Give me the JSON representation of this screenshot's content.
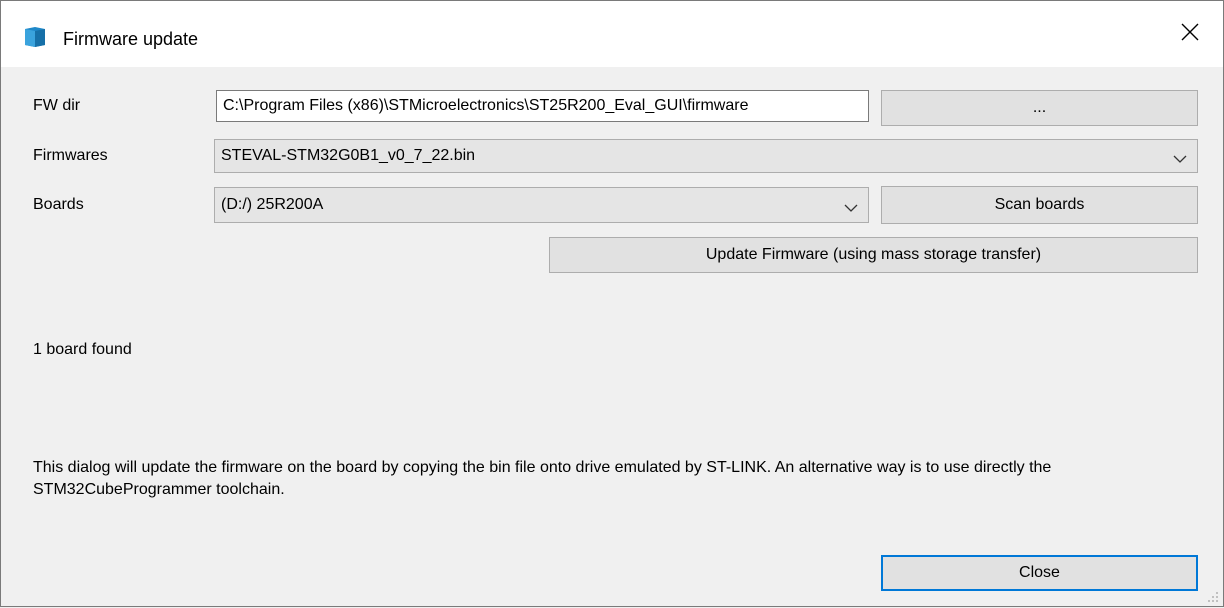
{
  "window": {
    "title": "Firmware update",
    "app_icon": "stm-cube-icon",
    "close_glyph": "✕"
  },
  "fw_dir": {
    "label": "FW dir",
    "value": "C:\\Program Files (x86)\\STMicroelectronics\\ST25R200_Eval_GUI\\firmware",
    "browse_label": "..."
  },
  "firmwares": {
    "label": "Firmwares",
    "selected": "STEVAL-STM32G0B1_v0_7_22.bin"
  },
  "boards": {
    "label": "Boards",
    "selected": "(D:/) 25R200A",
    "scan_label": "Scan boards"
  },
  "update_label": "Update Firmware (using mass storage transfer)",
  "status": "1 board found",
  "info_text": "This dialog will update the firmware on the board by copying the bin file onto drive emulated by ST-LINK. An alternative way is to use directly the STM32CubeProgrammer toolchain.",
  "close_label": "Close",
  "colors": {
    "accent": "#0078d7",
    "window_bg": "#f0f0f0",
    "button_bg": "#e1e1e1"
  }
}
